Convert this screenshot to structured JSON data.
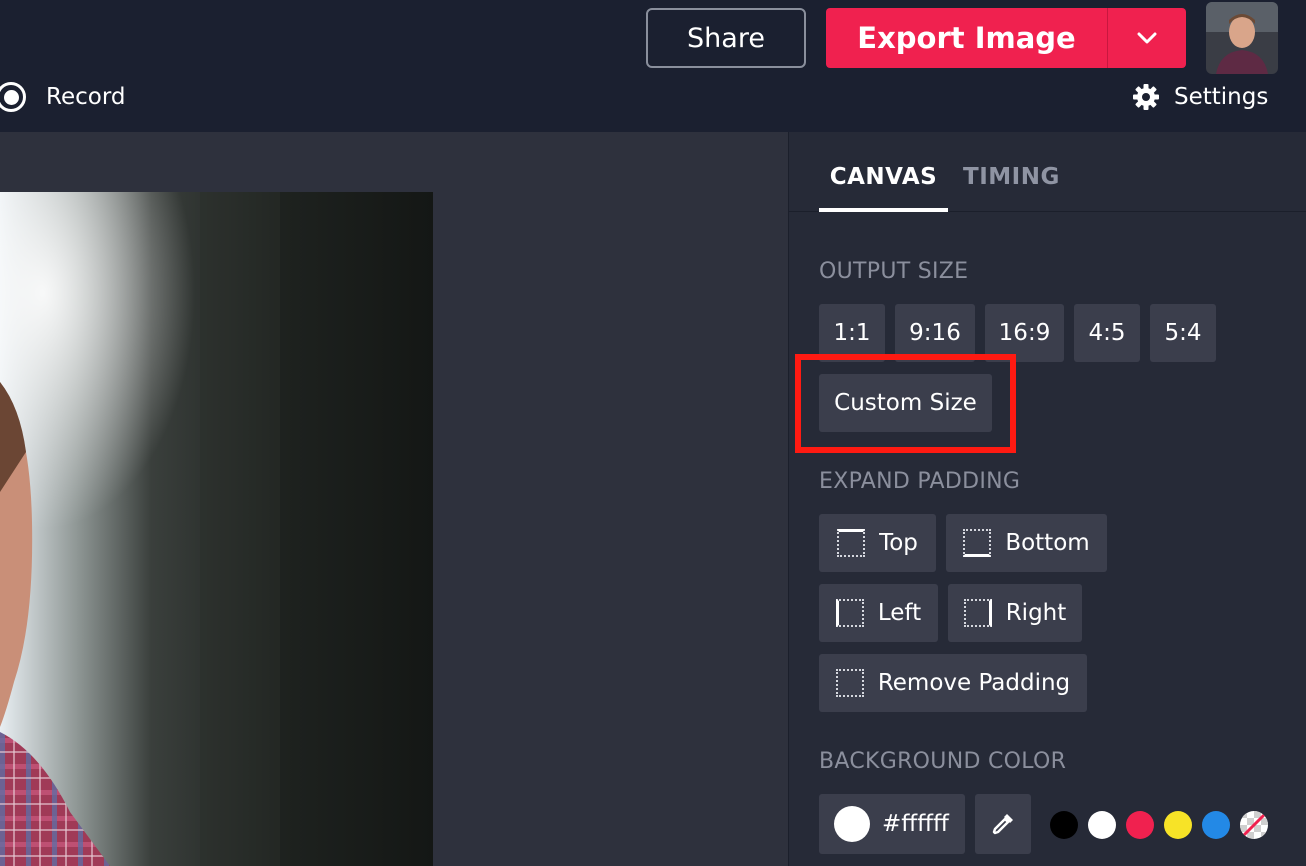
{
  "header": {
    "record_label": "Record",
    "share_label": "Share",
    "export_label": "Export Image",
    "settings_label": "Settings",
    "avatar_name": "user-avatar-photo"
  },
  "panel": {
    "tabs": [
      {
        "label": "CANVAS",
        "active": true
      },
      {
        "label": "TIMING",
        "active": false
      }
    ],
    "output_size": {
      "title": "OUTPUT SIZE",
      "ratios": [
        "1:1",
        "9:16",
        "16:9",
        "4:5",
        "5:4"
      ],
      "custom_label": "Custom Size"
    },
    "expand_padding": {
      "title": "EXPAND PADDING",
      "top_label": "Top",
      "bottom_label": "Bottom",
      "left_label": "Left",
      "right_label": "Right",
      "remove_label": "Remove Padding"
    },
    "background_color": {
      "title": "BACKGROUND COLOR",
      "value": "#ffffff",
      "presets": [
        "#000000",
        "#ffffff",
        "#f0214f",
        "#f7e327",
        "#2389e6",
        "transparent"
      ]
    }
  },
  "colors": {
    "accent": "#f0214f",
    "highlight": "#ff1a12",
    "topbar_bg": "#1b2030",
    "panel_bg": "#262a37",
    "workspace_bg": "#2e313d",
    "button_bg": "#3b3e4c"
  }
}
